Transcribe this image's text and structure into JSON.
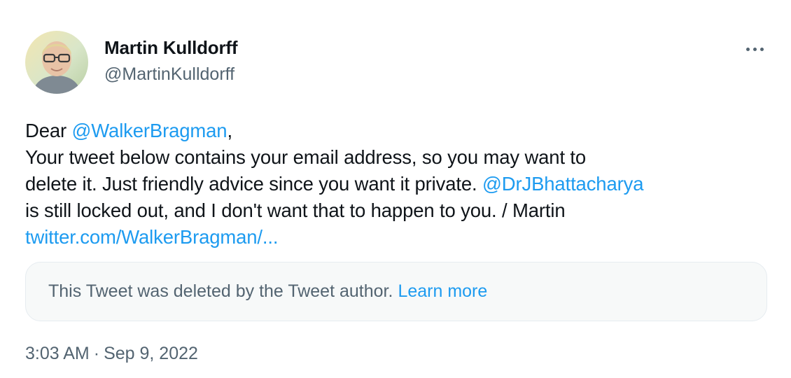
{
  "author": {
    "display_name": "Martin Kulldorff",
    "handle": "@MartinKulldorff"
  },
  "more_icon": "ellipsis-icon",
  "tweet": {
    "lines": [
      {
        "prefix": "Dear ",
        "mention": "@WalkerBragman",
        "suffix": ","
      },
      {
        "text": "Your tweet below contains your email address, so you may want to"
      },
      {
        "prefix": "delete it. Just friendly advice since you want it private. ",
        "mention": "@DrJBhattacharya"
      },
      {
        "text": "is still locked out, and I don't want that to happen to you. / Martin"
      },
      {
        "link": "twitter.com/WalkerBragman/..."
      }
    ]
  },
  "quoted_notice": {
    "text": "This Tweet was deleted by the Tweet author.",
    "link": "Learn more"
  },
  "timestamp": {
    "time": "3:03 AM",
    "separator": "·",
    "date": "Sep 9, 2022"
  },
  "colors": {
    "link": "#1d9bf0",
    "secondary_text": "#536471",
    "primary_text": "#0f1419",
    "notice_background": "#f7f9f9"
  }
}
